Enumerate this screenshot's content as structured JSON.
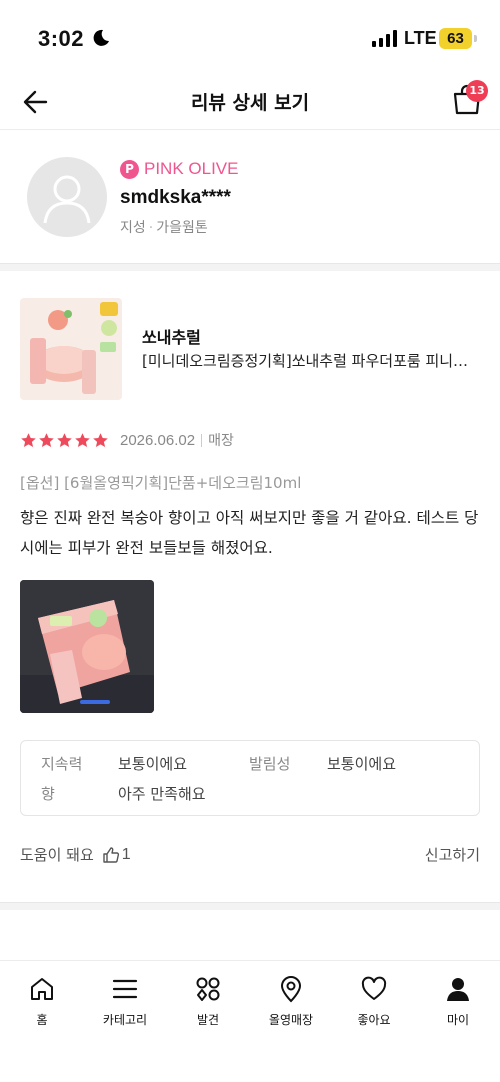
{
  "status_bar": {
    "time": "3:02",
    "network": "LTE",
    "battery": "63"
  },
  "header": {
    "title": "리뷰 상세 보기",
    "cart_count": "13"
  },
  "reviewer": {
    "grade": "PINK OLIVE",
    "grade_badge": "P",
    "nickname": "smdkska****",
    "skin_type": "지성",
    "skin_tone": "가을웜톤"
  },
  "product": {
    "brand": "쏘내추럴",
    "name": "[미니데오크림증정기획]쏘내추럴 파우더포룸 피니쉬 선쿠션"
  },
  "review": {
    "rating": 5,
    "date": "2026.06.02",
    "purchase_channel": "매장",
    "option": "[옵션] [6월올영픽기획]단품+데오크림10ml",
    "text": "향은 진짜 완전 복숭아 향이고 아직 써보지만 좋을 거 같아요. 테스트 당시에는 피부가 완전 보들보들 해졌어요."
  },
  "attributes": [
    {
      "key": "지속력",
      "value": "보통이에요"
    },
    {
      "key": "발림성",
      "value": "보통이에요"
    },
    {
      "key": "향",
      "value": "아주 만족해요"
    }
  ],
  "actions": {
    "helpful_label": "도움이 돼요",
    "helpful_count": "1",
    "report_label": "신고하기"
  },
  "tabs": [
    {
      "label": "홈",
      "icon": "home-icon"
    },
    {
      "label": "카테고리",
      "icon": "menu-icon"
    },
    {
      "label": "발견",
      "icon": "discover-icon"
    },
    {
      "label": "올영매장",
      "icon": "location-pin-icon"
    },
    {
      "label": "좋아요",
      "icon": "heart-icon"
    },
    {
      "label": "마이",
      "icon": "person-icon"
    }
  ],
  "colors": {
    "accent_pink": "#f0558f",
    "star_red": "#ee4a5c",
    "badge_red": "#ee3d55"
  }
}
